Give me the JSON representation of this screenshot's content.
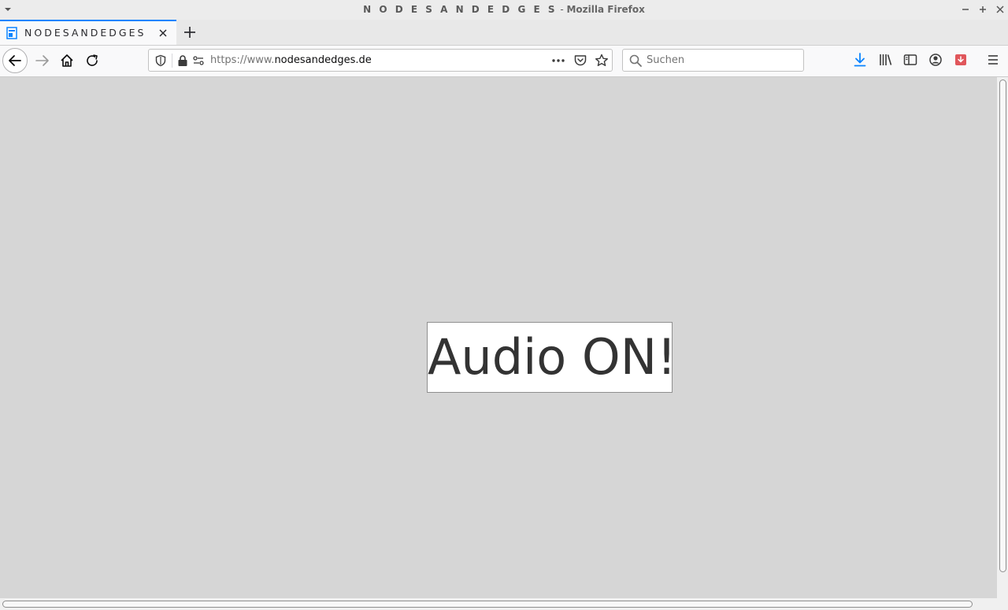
{
  "window": {
    "title_site": "N O D E S A N D E D G E S",
    "title_separator": " - ",
    "title_app": "Mozilla Firefox"
  },
  "tab": {
    "title": "NODESANDEDGES",
    "favicon": "page-icon"
  },
  "urlbar": {
    "url_prefix": "https://www.",
    "url_domain": "nodesandedges.de"
  },
  "search": {
    "placeholder": "Suchen"
  },
  "content": {
    "button_label": "Audio ON!"
  },
  "colors": {
    "accent": "#0a84ff",
    "content_background": "#d6d6d6",
    "download_icon": "#0a84ff",
    "pocket_save_icon": "#e0565b"
  },
  "icons": {
    "toolbar_right": [
      "downloads-icon",
      "library-icon",
      "sidebar-icon",
      "account-icon",
      "save-to-pocket-icon",
      "hamburger-menu-icon"
    ]
  }
}
